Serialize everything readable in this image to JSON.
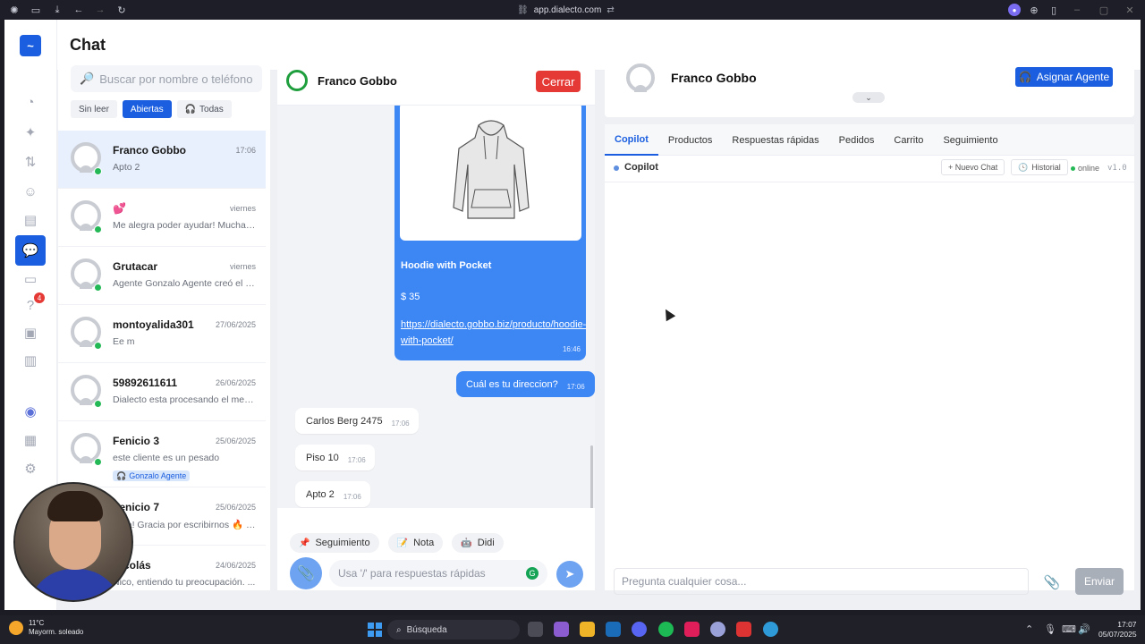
{
  "browser": {
    "url": "app.dialecto.com"
  },
  "header": {
    "title": "Chat"
  },
  "nav": {
    "badge_count": "4",
    "logo": "~"
  },
  "list": {
    "search_placeholder": "Buscar por nombre o teléfono",
    "filters": [
      {
        "label": "Sin leer"
      },
      {
        "label": "Abiertas"
      },
      {
        "label": "Todas"
      }
    ],
    "conversations": [
      {
        "name": "Franco Gobbo",
        "time": "17:06",
        "preview": "Apto 2"
      },
      {
        "name": "💕",
        "time": "viernes",
        "preview": "Me alegra poder ayudar! Mucha ..."
      },
      {
        "name": "Grutacar",
        "time": "viernes",
        "preview": "Agente Gonzalo Agente creó el ti..."
      },
      {
        "name": "montoyalida301",
        "time": "27/06/2025",
        "preview": "Ee m"
      },
      {
        "name": "59892611611",
        "time": "26/06/2025",
        "preview": "Dialecto esta procesando el men..."
      },
      {
        "name": "Fenicio 3",
        "time": "25/06/2025",
        "preview": "este cliente es un pesado",
        "tag": "Gonzalo Agente"
      },
      {
        "name": "Fenicio 7",
        "time": "25/06/2025",
        "preview": "Hola! Gracia por escribirnos 🔥 U..."
      },
      {
        "name": "Nicolás",
        "time": "24/06/2025",
        "preview": "Nico, entiendo tu preocupación. ..."
      }
    ]
  },
  "chat": {
    "contact_name": "Franco Gobbo",
    "close_label": "Cerrar",
    "product": {
      "name": "Hoodie with Pocket",
      "price": "$ 35",
      "link": "https://dialecto.gobbo.biz/producto/hoodie-with-pocket/",
      "time": "16:46"
    },
    "messages": [
      {
        "text": "Cuál es tu direccion?",
        "time": "17:06",
        "direction": "out"
      },
      {
        "text": "Carlos Berg 2475",
        "time": "17:06",
        "direction": "in"
      },
      {
        "text": "Piso 10",
        "time": "17:06",
        "direction": "in"
      },
      {
        "text": "Apto 2",
        "time": "17:06",
        "direction": "in"
      }
    ],
    "quick_actions": [
      {
        "label": "Seguimiento",
        "icon": "📌"
      },
      {
        "label": "Nota",
        "icon": "📝"
      },
      {
        "label": "Didi",
        "icon": "🤖"
      }
    ],
    "input_placeholder": "Usa '/' para respuestas rápidas"
  },
  "right": {
    "contact_name": "Franco Gobbo",
    "assign_label": "Asignar Agente",
    "tabs": [
      "Copilot",
      "Productos",
      "Respuestas rápidas",
      "Pedidos",
      "Carrito",
      "Seguimiento"
    ],
    "copilot": {
      "title": "Copilot",
      "new_chat": "+ Nuevo Chat",
      "history": "Historial",
      "status": "online",
      "version": "v1.0"
    },
    "ask_placeholder": "Pregunta cualquier cosa...",
    "send_label": "Enviar"
  },
  "taskbar": {
    "weather_temp": "11°C",
    "weather_desc": "Mayorm. soleado",
    "search_label": "Búsqueda",
    "time": "17:07",
    "date": "05/07/2025"
  },
  "colors": {
    "primary": "#1b5fe0",
    "bubble": "#3d87f5",
    "danger": "#e53935",
    "whatsapp": "#25b856"
  }
}
